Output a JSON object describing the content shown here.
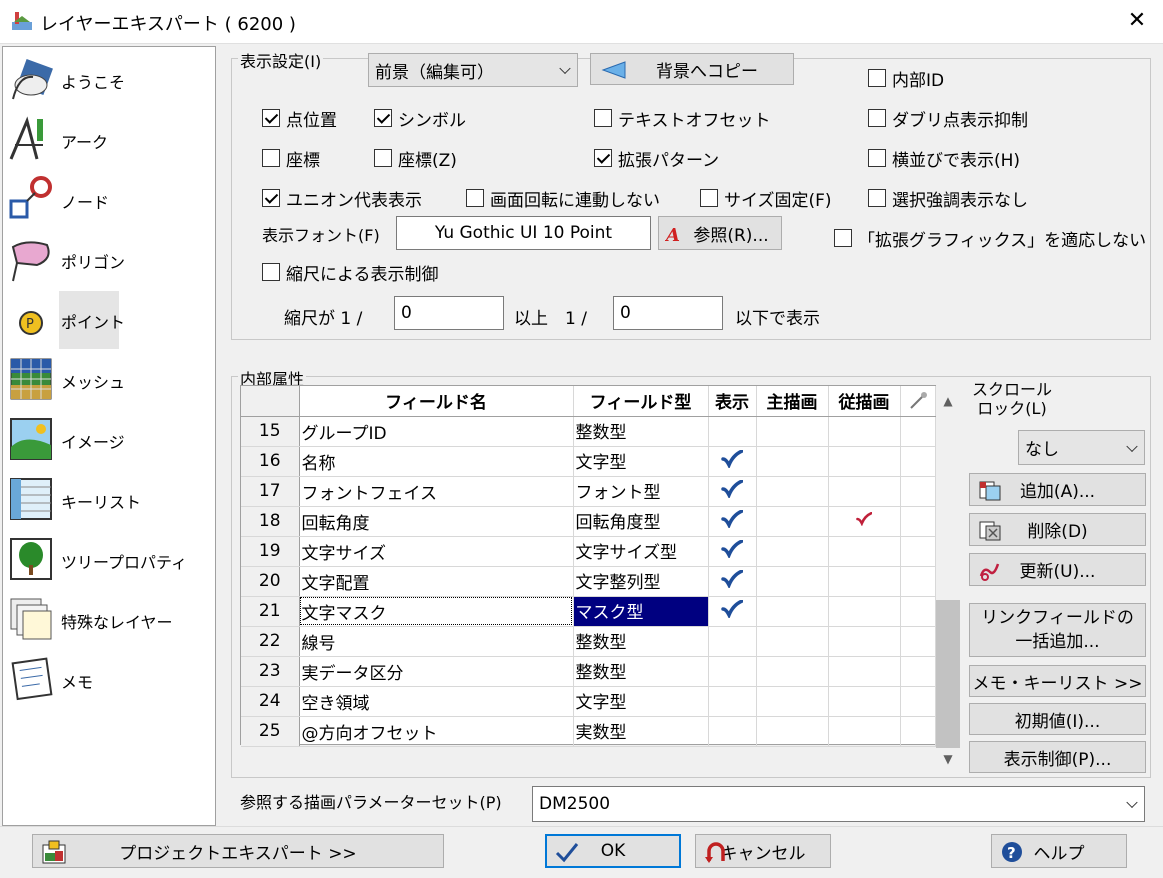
{
  "window": {
    "title": "レイヤーエキスパート ( 6200 )"
  },
  "sidebar": {
    "items": [
      {
        "label": "ようこそ",
        "icon": "welcome-icon"
      },
      {
        "label": "アーク",
        "icon": "arc-icon"
      },
      {
        "label": "ノード",
        "icon": "node-icon"
      },
      {
        "label": "ポリゴン",
        "icon": "polygon-icon"
      },
      {
        "label": "ポイント",
        "icon": "point-icon",
        "selected": true
      },
      {
        "label": "メッシュ",
        "icon": "mesh-icon"
      },
      {
        "label": "イメージ",
        "icon": "image-icon"
      },
      {
        "label": "キーリスト",
        "icon": "keylist-icon"
      },
      {
        "label": "ツリープロパティ",
        "icon": "tree-icon"
      },
      {
        "label": "特殊なレイヤー",
        "icon": "special-layer-icon"
      },
      {
        "label": "メモ",
        "icon": "memo-icon"
      }
    ]
  },
  "display": {
    "group_label": "表示設定(I)",
    "mode_value": "前景（編集可）",
    "copy_button": "背景へコピー",
    "checkboxes": {
      "internal_id": {
        "label": "内部ID",
        "checked": false
      },
      "point_position": {
        "label": "点位置",
        "checked": true
      },
      "symbol": {
        "label": "シンボル",
        "checked": true
      },
      "text_offset": {
        "label": "テキストオフセット",
        "checked": false
      },
      "dup_suppress": {
        "label": "ダブリ点表示抑制",
        "checked": false
      },
      "coord": {
        "label": "座標",
        "checked": false
      },
      "coord_z": {
        "label": "座標(Z)",
        "checked": false
      },
      "ext_pattern": {
        "label": "拡張パターン",
        "checked": true
      },
      "horizontal": {
        "label": "横並びで表示(H)",
        "checked": false
      },
      "union_rep": {
        "label": "ユニオン代表表示",
        "checked": true
      },
      "no_rotate": {
        "label": "画面回転に連動しない",
        "checked": false
      },
      "fixed_size": {
        "label": "サイズ固定(F)",
        "checked": false
      },
      "no_highlight": {
        "label": "選択強調表示なし",
        "checked": false
      },
      "no_ext_graphics": {
        "label": "「拡張グラフィックス」を適応しない",
        "checked": false
      },
      "scale_control": {
        "label": "縮尺による表示制御",
        "checked": false
      }
    },
    "font_label": "表示フォント(F)",
    "font_value": "Yu Gothic UI 10 Point",
    "browse_button": "参照(R)...",
    "scale_prefix": "縮尺が 1 /",
    "scale_min": "0",
    "scale_mid": "以上　1 /",
    "scale_max": "0",
    "scale_suffix": "以下で表示"
  },
  "attributes": {
    "group_label": "内部属性",
    "columns": [
      "フィールド名",
      "フィールド型",
      "表示",
      "主描画",
      "従描画"
    ],
    "rows": [
      {
        "num": "15",
        "name": "グループID",
        "type": "整数型",
        "show": false,
        "main": false,
        "sub": false
      },
      {
        "num": "16",
        "name": "名称",
        "type": "文字型",
        "show": true,
        "main": false,
        "sub": false
      },
      {
        "num": "17",
        "name": "フォントフェイス",
        "type": "フォント型",
        "show": true,
        "main": false,
        "sub": false
      },
      {
        "num": "18",
        "name": "回転角度",
        "type": "回転角度型",
        "show": true,
        "main": false,
        "sub": true
      },
      {
        "num": "19",
        "name": "文字サイズ",
        "type": "文字サイズ型",
        "show": true,
        "main": false,
        "sub": false
      },
      {
        "num": "20",
        "name": "文字配置",
        "type": "文字整列型",
        "show": true,
        "main": false,
        "sub": false
      },
      {
        "num": "21",
        "name": "文字マスク",
        "type": "マスク型",
        "show": true,
        "main": false,
        "sub": false,
        "selected": true
      },
      {
        "num": "22",
        "name": "線号",
        "type": "整数型",
        "show": false,
        "main": false,
        "sub": false
      },
      {
        "num": "23",
        "name": "実データ区分",
        "type": "整数型",
        "show": false,
        "main": false,
        "sub": false
      },
      {
        "num": "24",
        "name": "空き領域",
        "type": "文字型",
        "show": false,
        "main": false,
        "sub": false
      },
      {
        "num": "25",
        "name": "@方向オフセット",
        "type": "実数型",
        "show": false,
        "main": false,
        "sub": false
      }
    ],
    "scroll_lock_label": "スクロール\nロック(L)",
    "scroll_lock_value": "なし",
    "buttons": {
      "add": "追加(A)...",
      "delete": "削除(D)",
      "update": "更新(U)...",
      "link_bulk": "リンクフィールドの\n一括追加...",
      "memo_keylist": "メモ・キーリスト >>",
      "defaults": "初期値(I)...",
      "display_control": "表示制御(P)..."
    }
  },
  "param_set": {
    "label": "参照する描画パラメーターセット(P)",
    "value": "DM2500"
  },
  "footer": {
    "project_expert": "プロジェクトエキスパート >>",
    "ok": "OK",
    "cancel": "キャンセル",
    "help": "ヘルプ"
  },
  "colors": {
    "selection": "#000080",
    "check_blue": "#1f4e9a",
    "check_red": "#c0203a"
  }
}
